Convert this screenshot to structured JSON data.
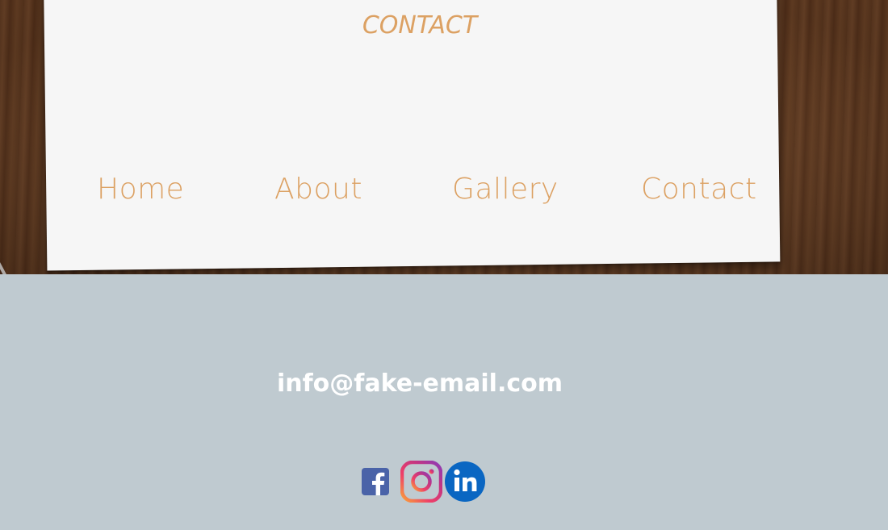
{
  "header": {
    "title": "CONTACT"
  },
  "nav": {
    "items": [
      {
        "label": "Home"
      },
      {
        "label": "About"
      },
      {
        "label": "Gallery"
      },
      {
        "label": "Contact"
      }
    ]
  },
  "footer": {
    "email": "info@fake-email.com",
    "social": [
      {
        "icon": "facebook-icon"
      },
      {
        "icon": "instagram-icon"
      },
      {
        "icon": "linkedin-icon"
      }
    ]
  },
  "colors": {
    "accent": "#dca163",
    "footer_bg": "#bfcad0",
    "paper": "#f6f6f6",
    "facebook": "#4a63a8",
    "linkedin": "#0a66c2"
  }
}
